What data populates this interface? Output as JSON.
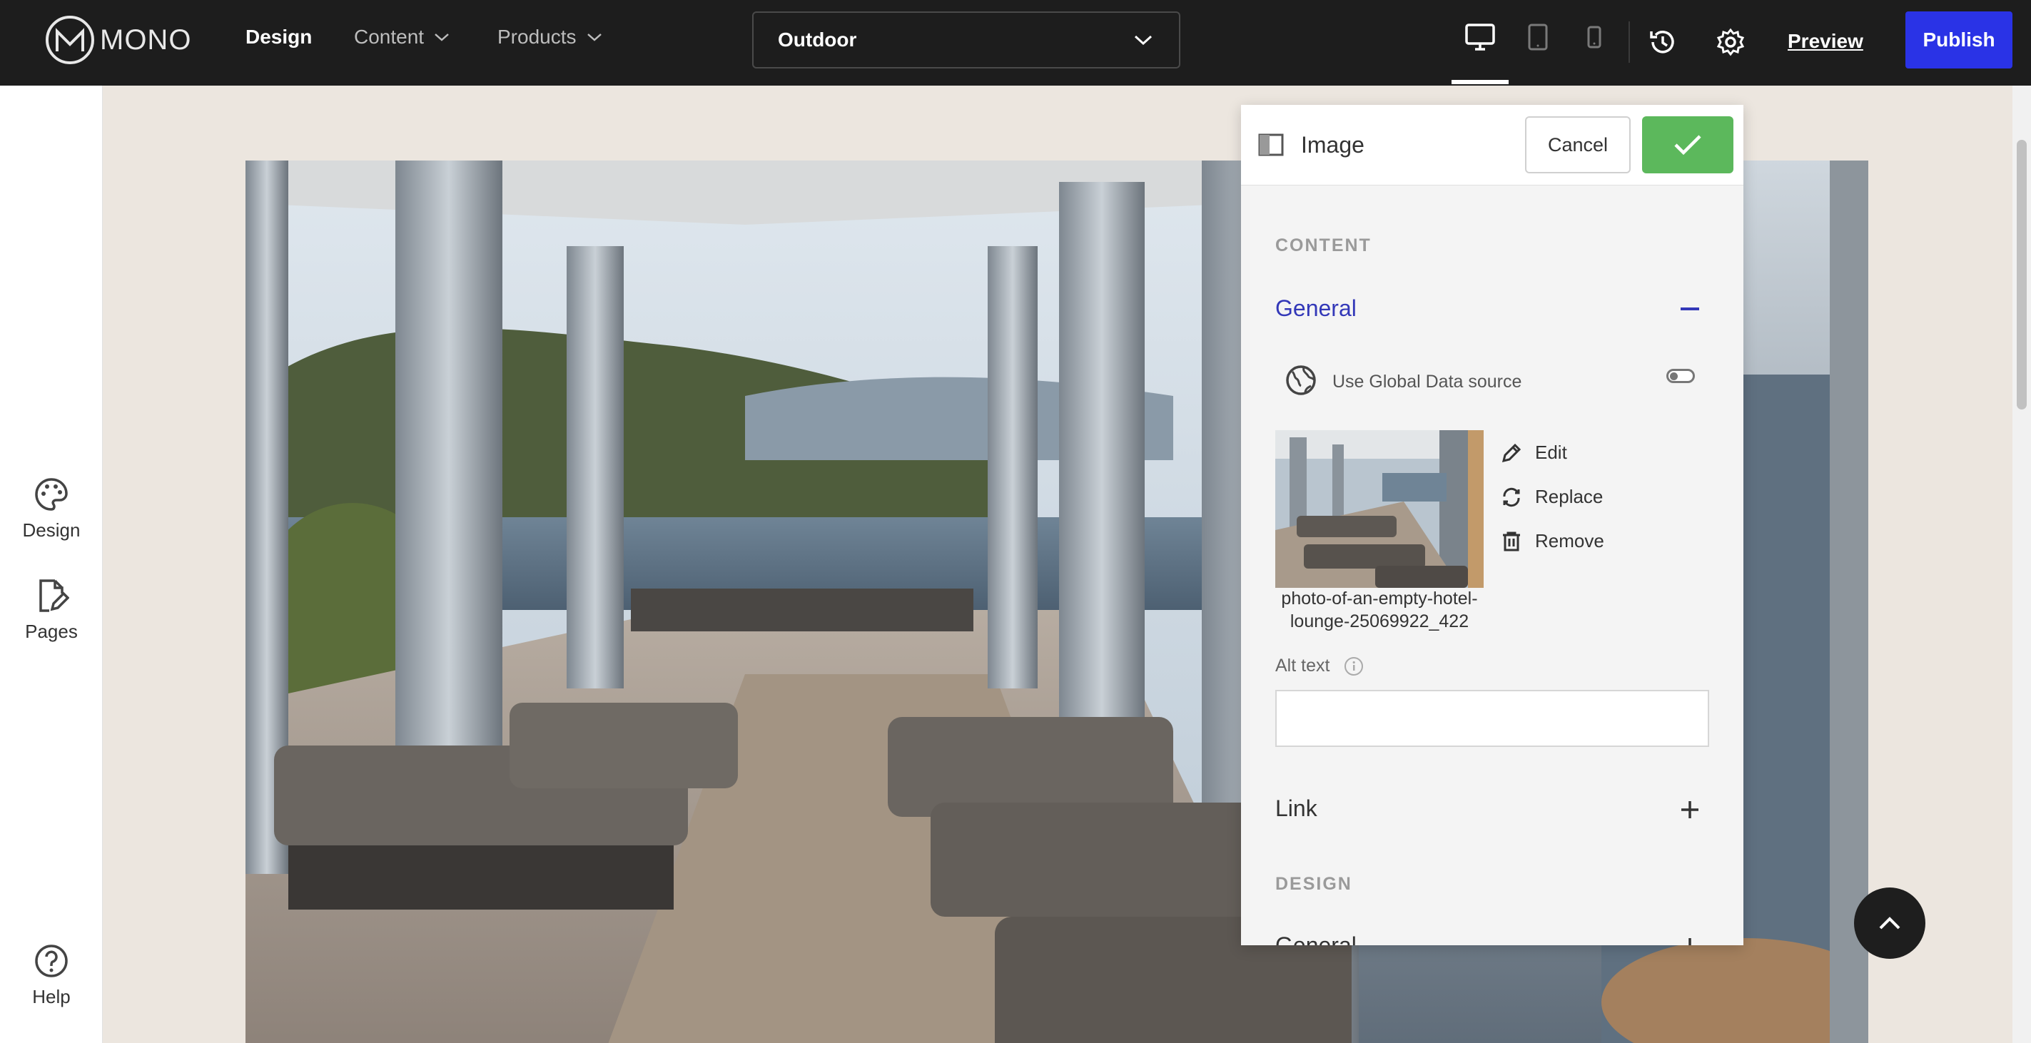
{
  "app": {
    "logo_text": "MONO"
  },
  "nav": {
    "design": "Design",
    "content": "Content",
    "products": "Products"
  },
  "page_select": {
    "value": "Outdoor"
  },
  "toolbar": {
    "preview": "Preview",
    "publish": "Publish"
  },
  "sidebar": {
    "design": "Design",
    "pages": "Pages",
    "help": "Help"
  },
  "panel": {
    "title": "Image",
    "cancel": "Cancel",
    "content_label": "CONTENT",
    "general_title": "General",
    "global_data_label": "Use Global Data source",
    "actions": {
      "edit": "Edit",
      "replace": "Replace",
      "remove": "Remove"
    },
    "filename": "photo-of-an-empty-hotel-lounge-25069922_422",
    "alt_label": "Alt text",
    "alt_value": "",
    "link_title": "Link",
    "design_label": "DESIGN",
    "design_general_title": "General"
  },
  "colors": {
    "topbar": "#1d1d1d",
    "publish": "#2a33e6",
    "confirm": "#5cb85c",
    "accent_heading": "#3338b8",
    "canvas_bg": "#ece6df"
  },
  "icons": [
    "palette-icon",
    "pages-icon",
    "help-icon",
    "desktop-icon",
    "tablet-icon",
    "mobile-icon",
    "history-icon",
    "gear-icon",
    "chevron-down-icon",
    "panel-layout-icon",
    "check-icon",
    "minus-icon",
    "plus-icon",
    "globe-icon",
    "pencil-icon",
    "replace-icon",
    "trash-icon",
    "info-icon",
    "arrow-up-icon"
  ]
}
